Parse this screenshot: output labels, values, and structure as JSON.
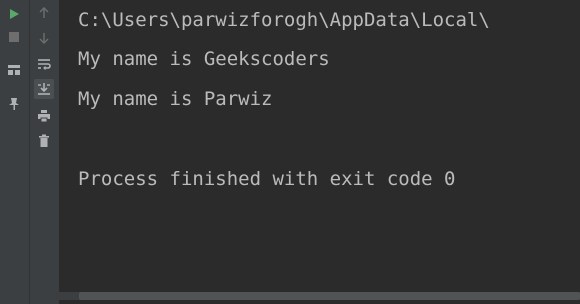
{
  "toolbar_left": {
    "buttons": [
      {
        "icon": "play-icon",
        "color": "#59a869",
        "interactable": true
      },
      {
        "icon": "stop-icon",
        "color": "#6e6e6e",
        "interactable": true
      },
      {
        "icon": "layout-icon",
        "color": "#afb1b3",
        "interactable": true
      },
      {
        "icon": "pin-icon",
        "color": "#afb1b3",
        "interactable": true
      }
    ]
  },
  "toolbar_mid": {
    "buttons": [
      {
        "icon": "arrow-up-icon",
        "color": "#6e6e6e",
        "interactable": true
      },
      {
        "icon": "arrow-down-icon",
        "color": "#6e6e6e",
        "interactable": true
      },
      {
        "icon": "soft-wrap-icon",
        "color": "#afb1b3",
        "interactable": true
      },
      {
        "icon": "scroll-to-end-icon",
        "color": "#afb1b3",
        "interactable": true,
        "active": true
      },
      {
        "icon": "print-icon",
        "color": "#afb1b3",
        "interactable": true
      },
      {
        "icon": "trash-icon",
        "color": "#afb1b3",
        "interactable": true
      }
    ]
  },
  "console": {
    "lines": [
      "C:\\Users\\parwizforogh\\AppData\\Local\\",
      "My name is Geekscoders",
      "My name is Parwiz",
      "",
      "Process finished with exit code 0"
    ]
  }
}
